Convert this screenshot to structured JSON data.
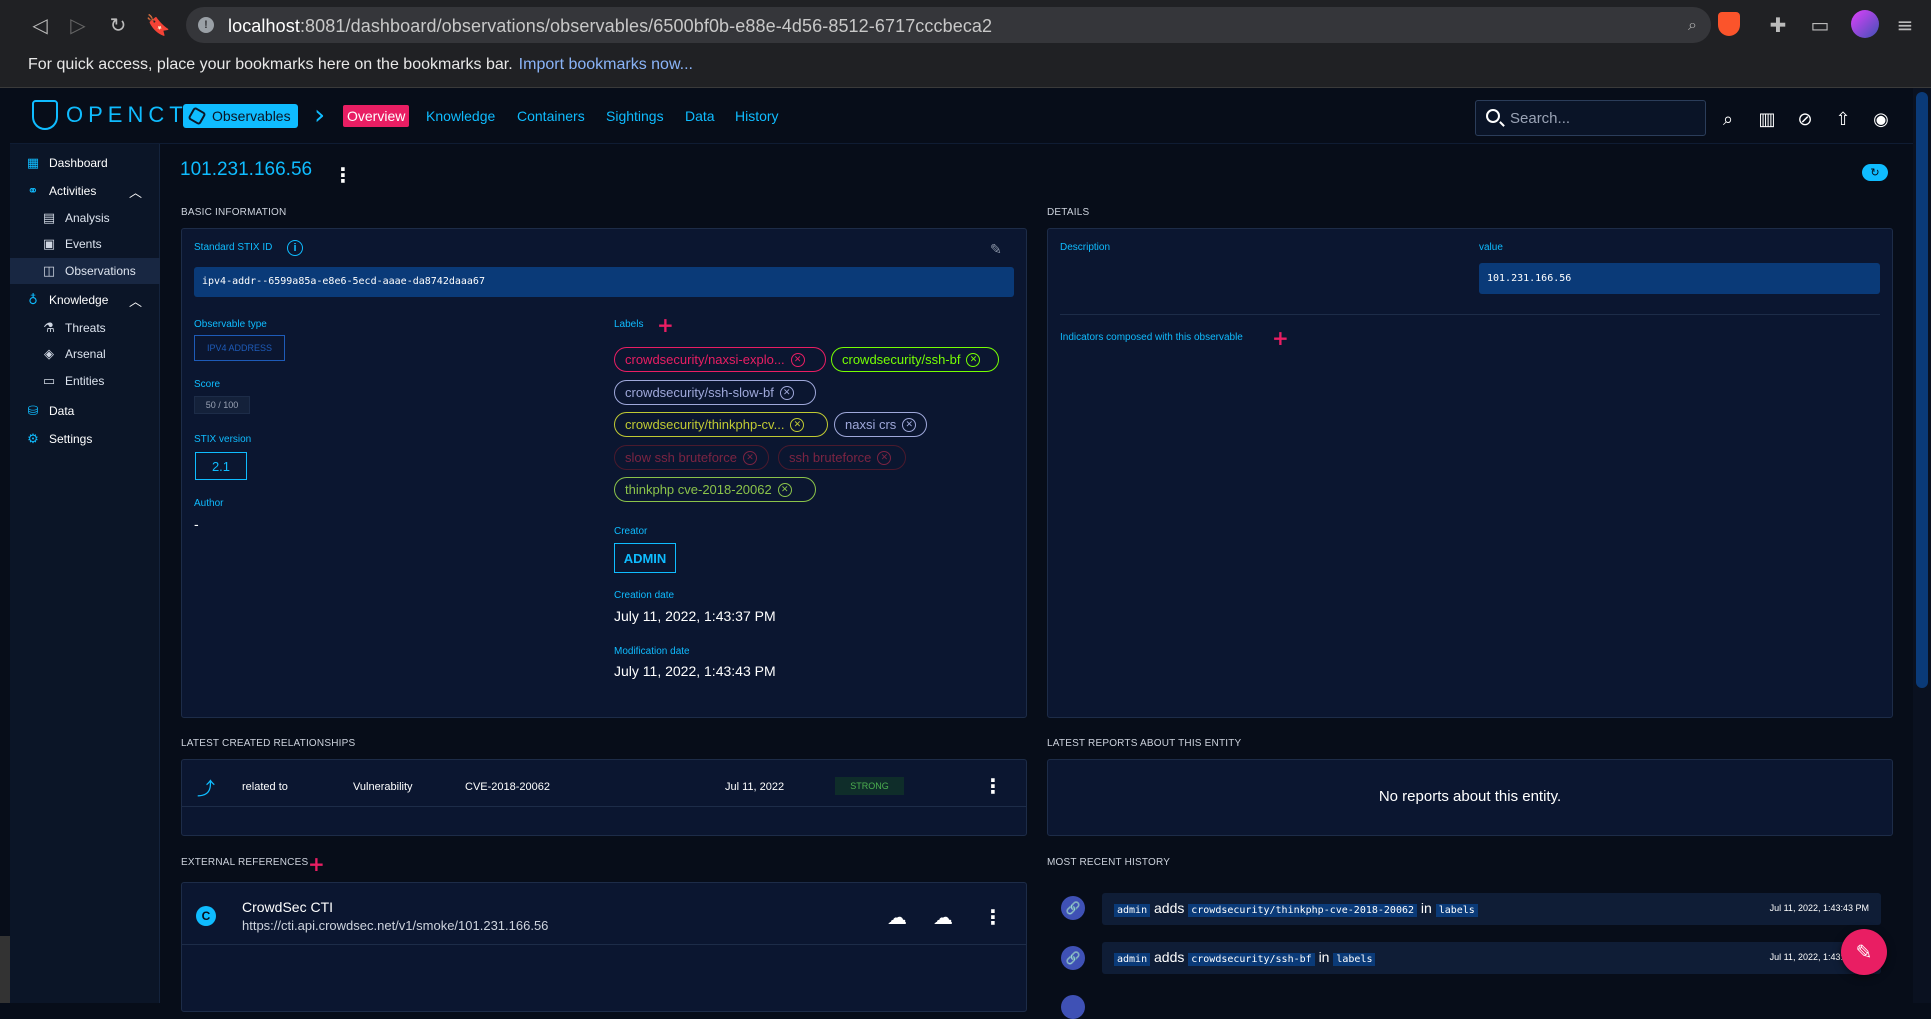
{
  "browser": {
    "url_host": "localhost",
    "url_path": ":8081/dashboard/observations/observables/6500bf0b-e88e-4d56-8512-6717cccbeca2",
    "bookmarks_prompt": "For quick access, place your bookmarks here on the bookmarks bar.",
    "bookmarks_link": "Import bookmarks now..."
  },
  "app": {
    "logo_text": "OPENCTI",
    "breadcrumb_chip": "Observables",
    "tabs": [
      "Overview",
      "Knowledge",
      "Containers",
      "Sightings",
      "Data",
      "History"
    ],
    "active_tab": "Overview",
    "search_placeholder": "Search..."
  },
  "sidebar": {
    "dashboard": "Dashboard",
    "activities": "Activities",
    "analysis": "Analysis",
    "events": "Events",
    "observations": "Observations",
    "knowledge": "Knowledge",
    "threats": "Threats",
    "arsenal": "Arsenal",
    "entities": "Entities",
    "data": "Data",
    "settings": "Settings"
  },
  "entity": {
    "title": "101.231.166.56"
  },
  "basic_info": {
    "section_title": "BASIC INFORMATION",
    "stix_id_label": "Standard STIX ID",
    "stix_id": "ipv4-addr--6599a85a-e8e6-5ecd-aaae-da8742daaa67",
    "observable_type_label": "Observable type",
    "observable_type": "IPV4 ADDRESS",
    "score_label": "Score",
    "score": "50 / 100",
    "stix_version_label": "STIX version",
    "stix_version": "2.1",
    "author_label": "Author",
    "author": "-",
    "labels_label": "Labels",
    "labels": [
      {
        "text": "crowdsecurity/naxsi-explo...",
        "color": "#e91e63"
      },
      {
        "text": "crowdsecurity/ssh-bf",
        "color": "#76ff03"
      },
      {
        "text": "crowdsecurity/ssh-slow-bf",
        "color": "#9fa8da"
      },
      {
        "text": "crowdsecurity/thinkphp-cv...",
        "color": "#c0ca33"
      },
      {
        "text": "naxsi crs",
        "color": "#9fa8da"
      },
      {
        "text": "slow ssh bruteforce",
        "color": "#7b2442"
      },
      {
        "text": "ssh bruteforce",
        "color": "#7b2442"
      },
      {
        "text": "thinkphp cve-2018-20062",
        "color": "#8bc34a"
      }
    ],
    "creator_label": "Creator",
    "creator": "ADMIN",
    "creation_date_label": "Creation date",
    "creation_date": "July 11, 2022, 1:43:37 PM",
    "modification_date_label": "Modification date",
    "modification_date": "July 11, 2022, 1:43:43 PM"
  },
  "details": {
    "section_title": "DETAILS",
    "description_label": "Description",
    "value_label": "value",
    "value": "101.231.166.56",
    "indicators_label": "Indicators composed with this observable"
  },
  "relationships": {
    "section_title": "LATEST CREATED RELATIONSHIPS",
    "rows": [
      {
        "type": "related to",
        "entity_type": "Vulnerability",
        "name": "CVE-2018-20062",
        "date": "Jul 11, 2022",
        "confidence": "STRONG"
      }
    ]
  },
  "reports": {
    "section_title": "LATEST REPORTS ABOUT THIS ENTITY",
    "empty": "No reports about this entity."
  },
  "external_refs": {
    "section_title": "EXTERNAL REFERENCES",
    "items": [
      {
        "name": "CrowdSec CTI",
        "url": "https://cti.api.crowdsec.net/v1/smoke/101.231.166.56"
      }
    ]
  },
  "history": {
    "section_title": "MOST RECENT HISTORY",
    "rows": [
      {
        "user": "admin",
        "action": "adds",
        "value": "crowdsecurity/thinkphp-cve-2018-20062",
        "prep": "in",
        "field": "labels",
        "date": "Jul 11, 2022, 1:43:43 PM"
      },
      {
        "user": "admin",
        "action": "adds",
        "value": "crowdsecurity/ssh-bf",
        "prep": "in",
        "field": "labels",
        "date": "Jul 11, 2022, 1:43:43 PM"
      }
    ]
  },
  "colors": {
    "accent": "#0fbcff",
    "active_tab": "#e91e63",
    "background": "#070d19",
    "panel": "#0b1630"
  }
}
